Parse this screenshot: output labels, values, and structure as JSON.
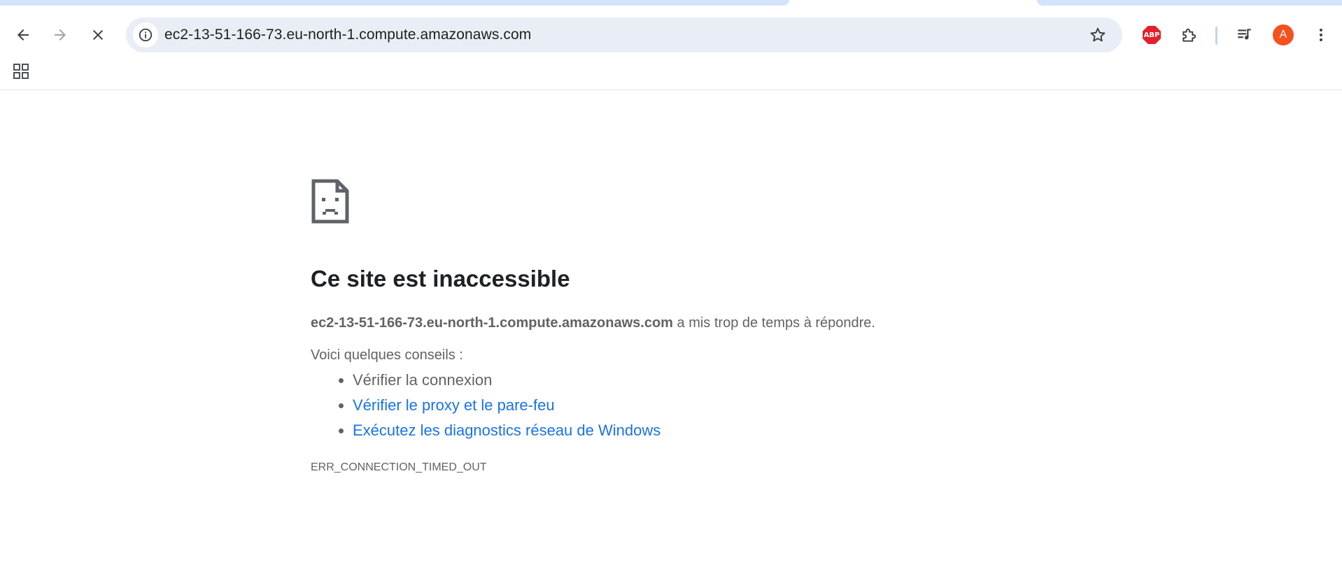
{
  "browser": {
    "url": "ec2-13-51-166-73.eu-north-1.compute.amazonaws.com",
    "icons": [
      "back-arrow-icon",
      "forward-arrow-icon",
      "stop-loading-icon",
      "site-info-icon",
      "bookmark-star-icon",
      "adblock-plus-icon",
      "extensions-puzzle-icon",
      "media-control-icon",
      "more-vert-icon",
      "apps-grid-icon"
    ],
    "extension_label": "ABP",
    "profile_initial": "A",
    "colors": {
      "accent": "#d3e3fd",
      "omnibox": "#e9eef6",
      "avatar": "#f4511e",
      "link": "#1a73e8",
      "abp": "#e51f2c"
    }
  },
  "error_page": {
    "title": "Ce site est inaccessible",
    "host": "ec2-13-51-166-73.eu-north-1.compute.amazonaws.com",
    "description_suffix": " a mis trop de temps à répondre.",
    "tips_label": "Voici quelques conseils :",
    "tips": [
      {
        "text": "Vérifier la connexion",
        "link": false
      },
      {
        "text": "Vérifier le proxy et le pare-feu",
        "link": true
      },
      {
        "text": "Exécutez les diagnostics réseau de Windows",
        "link": true
      }
    ],
    "error_code": "ERR_CONNECTION_TIMED_OUT"
  }
}
